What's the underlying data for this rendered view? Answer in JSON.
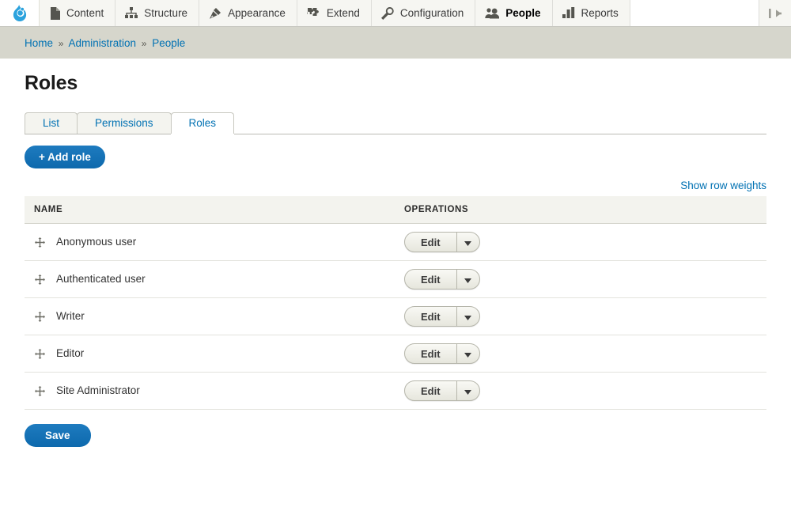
{
  "toolbar": {
    "logo_name": "drupal-logo",
    "items": [
      {
        "label": "Content",
        "icon": "document-icon",
        "active": false
      },
      {
        "label": "Structure",
        "icon": "hierarchy-icon",
        "active": false
      },
      {
        "label": "Appearance",
        "icon": "paintbrush-icon",
        "active": false
      },
      {
        "label": "Extend",
        "icon": "puzzle-piece-icon",
        "active": false
      },
      {
        "label": "Configuration",
        "icon": "wrench-icon",
        "active": false
      },
      {
        "label": "People",
        "icon": "people-icon",
        "active": true
      },
      {
        "label": "Reports",
        "icon": "bar-chart-icon",
        "active": false
      }
    ],
    "collapse_icon": "collapse-toolbar-icon"
  },
  "breadcrumb": {
    "items": [
      "Home",
      "Administration",
      "People"
    ],
    "separator": "»"
  },
  "page": {
    "title": "Roles"
  },
  "tabs": [
    {
      "label": "List",
      "active": false
    },
    {
      "label": "Permissions",
      "active": false
    },
    {
      "label": "Roles",
      "active": true
    }
  ],
  "actions": {
    "add_role_label": "+ Add role",
    "save_label": "Save",
    "show_row_weights_label": "Show row weights"
  },
  "table": {
    "columns": [
      "NAME",
      "OPERATIONS"
    ],
    "rows": [
      {
        "name": "Anonymous user",
        "operation_label": "Edit"
      },
      {
        "name": "Authenticated user",
        "operation_label": "Edit"
      },
      {
        "name": "Writer",
        "operation_label": "Edit"
      },
      {
        "name": "Editor",
        "operation_label": "Edit"
      },
      {
        "name": "Site Administrator",
        "operation_label": "Edit"
      }
    ]
  },
  "colors": {
    "accent_blue": "#0071b3",
    "button_blue": "#0d69ad",
    "breadcrumb_band": "#d6d6cc",
    "toolbar_tab_bg": "#f6f6f2",
    "table_header_bg": "#f3f3ee"
  }
}
